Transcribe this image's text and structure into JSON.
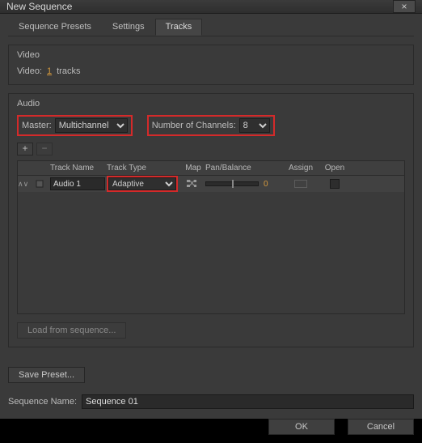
{
  "window": {
    "title": "New Sequence"
  },
  "tabs": {
    "items": [
      "Sequence Presets",
      "Settings",
      "Tracks"
    ],
    "active": 2
  },
  "video": {
    "group_label": "Video",
    "label": "Video:",
    "count": "1",
    "suffix": "tracks"
  },
  "audio": {
    "group_label": "Audio",
    "master_label": "Master:",
    "master_value": "Multichannel",
    "channels_label": "Number of Channels:",
    "channels_value": "8",
    "add_label": "+",
    "remove_label": "−",
    "headers": {
      "name": "Track Name",
      "type": "Track Type",
      "map": "Map",
      "pan": "Pan/Balance",
      "assign": "Assign",
      "open": "Open"
    },
    "tracks": [
      {
        "name": "Audio 1",
        "type": "Adaptive",
        "pan": "0"
      }
    ],
    "load_label": "Load from sequence..."
  },
  "save_preset_label": "Save Preset...",
  "sequence_name_label": "Sequence Name:",
  "sequence_name_value": "Sequence 01",
  "buttons": {
    "ok": "OK",
    "cancel": "Cancel"
  }
}
